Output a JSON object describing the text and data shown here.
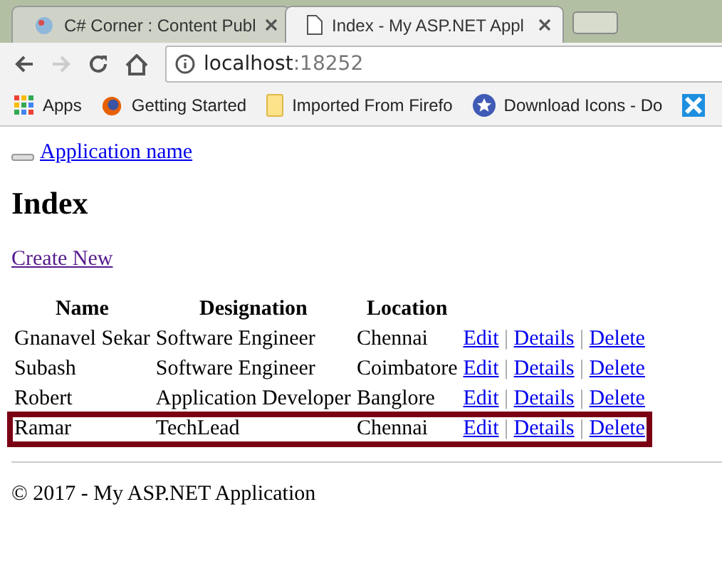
{
  "browser": {
    "tabs": [
      {
        "title": "C# Corner : Content Publ",
        "selected": false
      },
      {
        "title": "Index - My ASP.NET Appl",
        "selected": true
      }
    ],
    "address": {
      "host": "localhost",
      "port": ":18252"
    },
    "bookmarks": [
      {
        "label": "Apps",
        "kind": "apps"
      },
      {
        "label": "Getting Started",
        "kind": "firefox"
      },
      {
        "label": "Imported From Firefo",
        "kind": "folder"
      },
      {
        "label": "Download Icons - Do",
        "kind": "star"
      },
      {
        "kind": "x"
      }
    ]
  },
  "page": {
    "brand": "Application name",
    "heading": "Index",
    "create_link": "Create New",
    "table": {
      "columns": [
        "Name",
        "Designation",
        "Location"
      ],
      "rows": [
        {
          "cells": [
            "Gnanavel Sekar",
            "Software Engineer",
            "Chennai"
          ],
          "actions": [
            "Edit",
            "|",
            "Details",
            "|",
            "Delete"
          ],
          "highlighted": false
        },
        {
          "cells": [
            "Subash",
            "Software Engineer",
            "Coimbatore"
          ],
          "actions": [
            "Edit",
            "|",
            "Details",
            "|",
            "Delete"
          ],
          "highlighted": false
        },
        {
          "cells": [
            "Robert",
            "Application Developer",
            "Banglore"
          ],
          "actions": [
            "Edit",
            "|",
            "Details",
            "|",
            "Delete"
          ],
          "highlighted": false
        },
        {
          "cells": [
            "Ramar",
            "TechLead",
            "Chennai"
          ],
          "actions": [
            "Edit",
            "|",
            "Details",
            "|",
            "Delete"
          ],
          "highlighted": true
        }
      ]
    },
    "footer": "© 2017 - My ASP.NET Application"
  }
}
